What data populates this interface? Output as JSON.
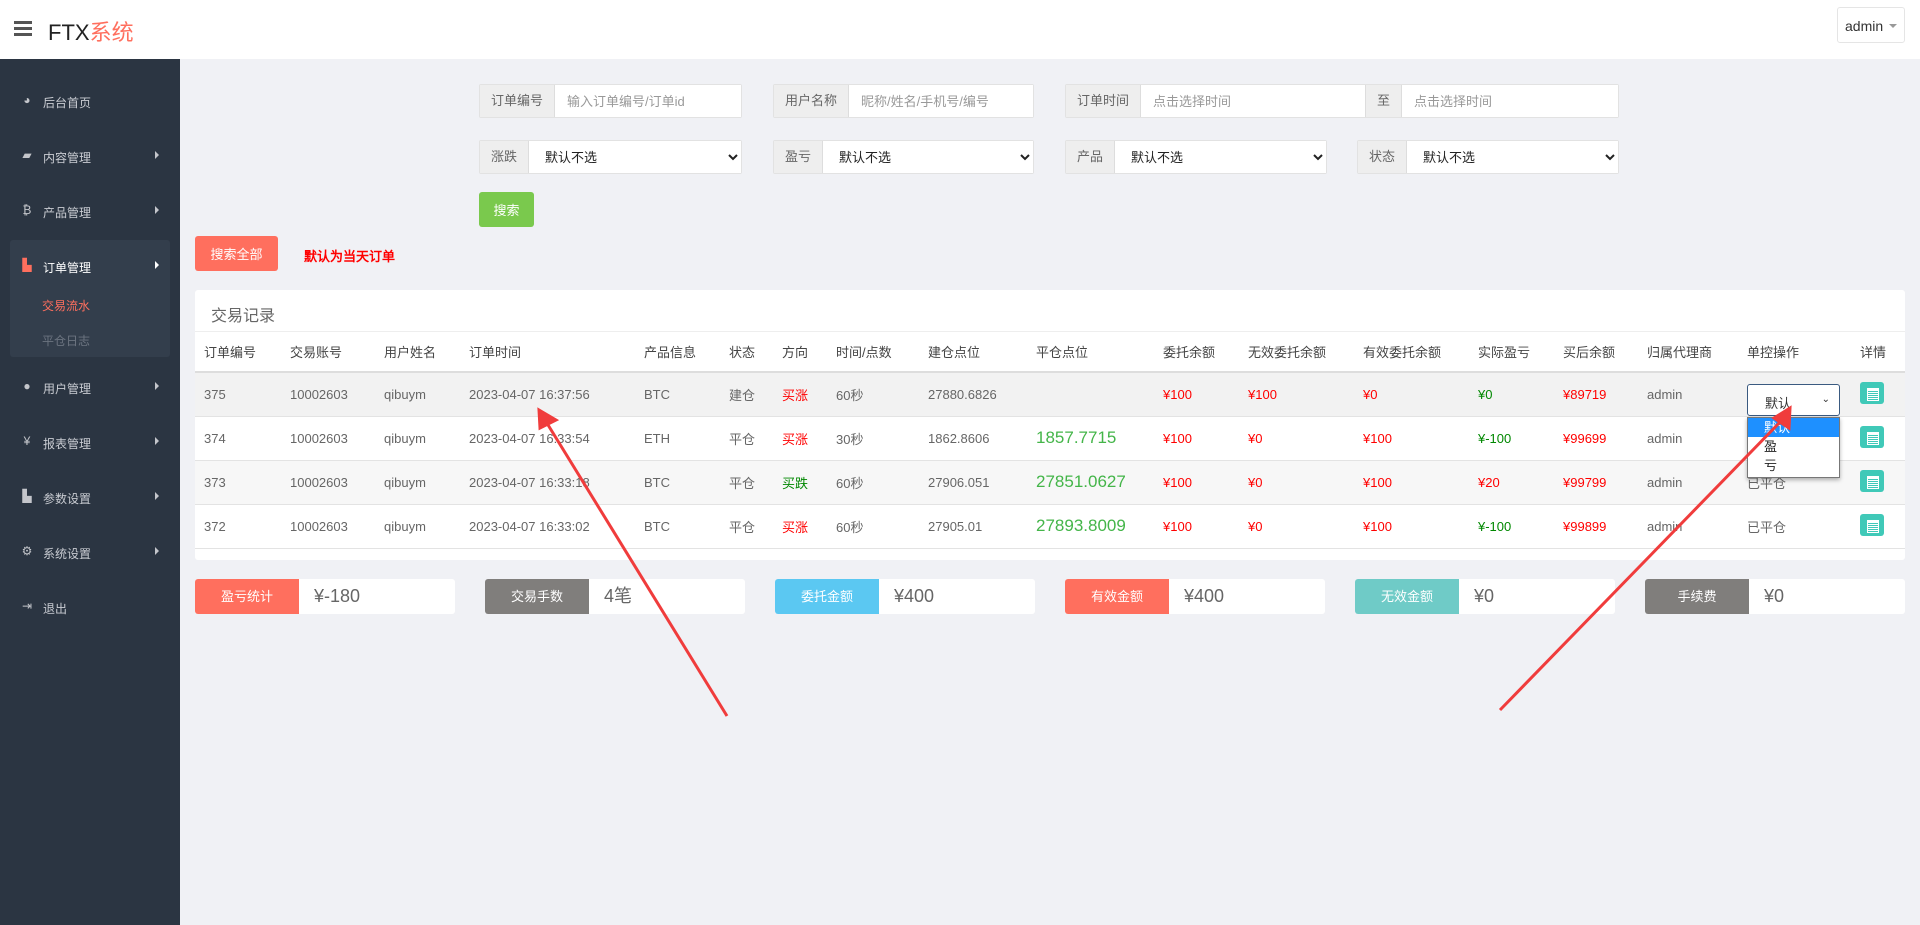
{
  "header": {
    "logo_main": "FTX",
    "logo_accent": "系统",
    "user": "admin"
  },
  "sidebar": {
    "items": [
      {
        "label": "后台首页",
        "icon": "dashboard-icon"
      },
      {
        "label": "内容管理",
        "icon": "book-icon"
      },
      {
        "label": "产品管理",
        "icon": "bitcoin-icon"
      },
      {
        "label": "订单管理",
        "icon": "copy-icon"
      },
      {
        "label": "用户管理",
        "icon": "user-icon"
      },
      {
        "label": "报表管理",
        "icon": "yen-icon"
      },
      {
        "label": "参数设置",
        "icon": "files-icon"
      },
      {
        "label": "系统设置",
        "icon": "gears-icon"
      },
      {
        "label": "退出",
        "icon": "sign-out-icon"
      }
    ],
    "sub_items": [
      {
        "label": "交易流水"
      },
      {
        "label": "平仓日志"
      }
    ]
  },
  "filters": {
    "order_no": {
      "label": "订单编号",
      "placeholder": "输入订单编号/订单id"
    },
    "user": {
      "label": "用户名称",
      "placeholder": "昵称/姓名/手机号/编号"
    },
    "time": {
      "label": "订单时间",
      "placeholder_start": "点击选择时间",
      "to": "至",
      "placeholder_end": "点击选择时间"
    },
    "rise_fall": {
      "label": "涨跌",
      "value": "默认不选"
    },
    "profit": {
      "label": "盈亏",
      "value": "默认不选"
    },
    "product": {
      "label": "产品",
      "value": "默认不选"
    },
    "status": {
      "label": "状态",
      "value": "默认不选"
    },
    "search": "搜索",
    "search_all": "搜索全部",
    "note": "默认为当天订单"
  },
  "table": {
    "title": "交易记录",
    "headers": [
      "订单编号",
      "交易账号",
      "用户姓名",
      "订单时间",
      "产品信息",
      "状态",
      "方向",
      "时间/点数",
      "建仓点位",
      "平仓点位",
      "委托余额",
      "无效委托余额",
      "有效委托余额",
      "实际盈亏",
      "买后余额",
      "归属代理商",
      "单控操作",
      "详情"
    ],
    "rows": [
      {
        "id": "375",
        "account": "10002603",
        "name": "qibuym",
        "time": "2023-04-07 16:37:56",
        "product": "BTC",
        "status": "建仓",
        "dir": "买涨",
        "dur": "60秒",
        "open": "27880.6826",
        "close": "",
        "amount": "¥100",
        "invalid": "¥100",
        "valid": "¥0",
        "pnl": "¥0",
        "after": "¥89719",
        "agent": "admin",
        "op": ""
      },
      {
        "id": "374",
        "account": "10002603",
        "name": "qibuym",
        "time": "2023-04-07 16:33:54",
        "product": "ETH",
        "status": "平仓",
        "dir": "买涨",
        "dur": "30秒",
        "open": "1862.8606",
        "close": "1857.7715",
        "amount": "¥100",
        "invalid": "¥0",
        "valid": "¥100",
        "pnl": "¥-100",
        "after": "¥99699",
        "agent": "admin",
        "op": ""
      },
      {
        "id": "373",
        "account": "10002603",
        "name": "qibuym",
        "time": "2023-04-07 16:33:18",
        "product": "BTC",
        "status": "平仓",
        "dir": "买跌",
        "dur": "60秒",
        "open": "27906.051",
        "close": "27851.0627",
        "amount": "¥100",
        "invalid": "¥0",
        "valid": "¥100",
        "pnl": "¥20",
        "after": "¥99799",
        "agent": "admin",
        "op": "已平仓"
      },
      {
        "id": "372",
        "account": "10002603",
        "name": "qibuym",
        "time": "2023-04-07 16:33:02",
        "product": "BTC",
        "status": "平仓",
        "dir": "买涨",
        "dur": "60秒",
        "open": "27905.01",
        "close": "27893.8009",
        "amount": "¥100",
        "invalid": "¥0",
        "valid": "¥100",
        "pnl": "¥-100",
        "after": "¥99899",
        "agent": "admin",
        "op": "已平仓"
      }
    ],
    "control": {
      "value": "默认",
      "options": [
        "默认",
        "盈",
        "亏"
      ]
    }
  },
  "stats": [
    {
      "label": "盈亏统计",
      "value": "¥-180",
      "color": "#ff6f5e"
    },
    {
      "label": "交易手数",
      "value": "4笔",
      "color": "#807e7c"
    },
    {
      "label": "委托金额",
      "value": "¥400",
      "color": "#5bc8f2"
    },
    {
      "label": "有效金额",
      "value": "¥400",
      "color": "#ff6f5e"
    },
    {
      "label": "无效金额",
      "value": "¥0",
      "color": "#6fcbc7"
    },
    {
      "label": "手续费",
      "value": "¥0",
      "color": "#807e7c"
    }
  ]
}
